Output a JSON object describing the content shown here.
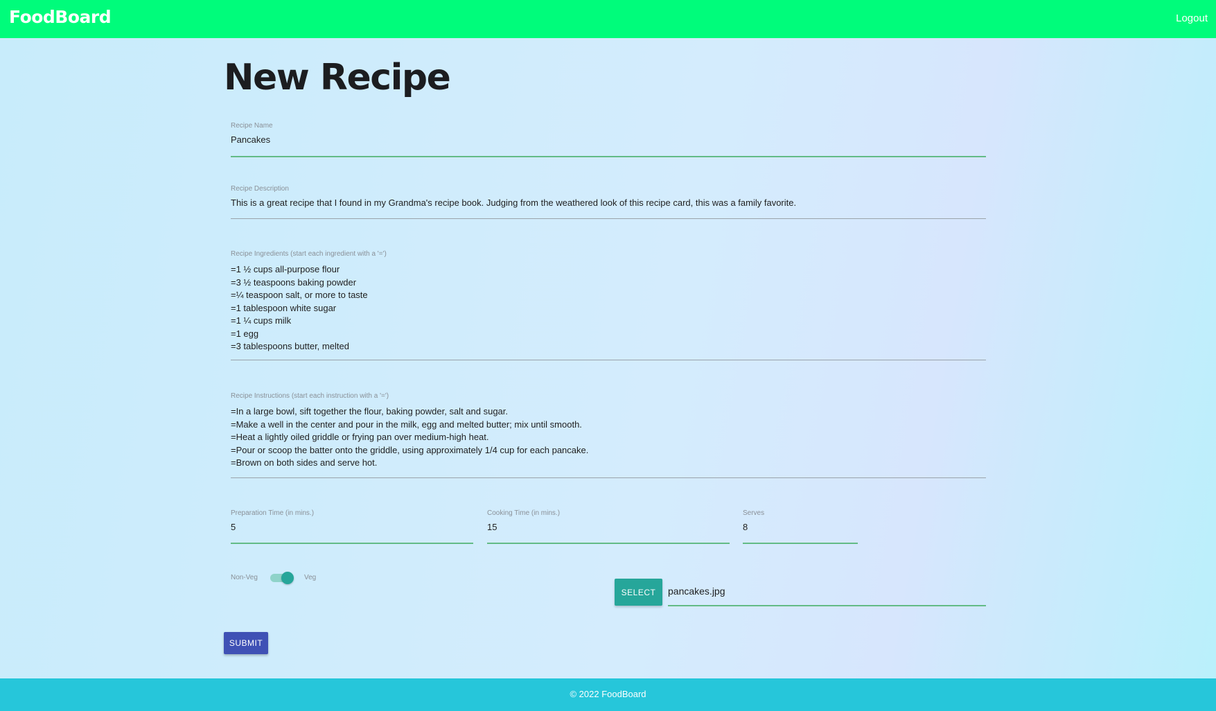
{
  "header": {
    "brand": "FoodBoard",
    "logout_label": "Logout"
  },
  "page": {
    "title": "New Recipe"
  },
  "form": {
    "recipe_name": {
      "label": "Recipe Name",
      "value": "Pancakes"
    },
    "recipe_description": {
      "label": "Recipe Description",
      "value": "This is a great recipe that I found in my Grandma's recipe book. Judging from the weathered look of this recipe card, this was a family favorite."
    },
    "recipe_ingredients": {
      "label": "Recipe Ingredients (start each ingredient with a '=')",
      "lines": [
        "=1 ½ cups all-purpose flour",
        "=3 ½ teaspoons baking powder",
        "=¼ teaspoon salt, or more to taste",
        "=1 tablespoon white sugar",
        "=1 ¼ cups milk",
        "=1 egg",
        "=3 tablespoons butter, melted"
      ]
    },
    "recipe_instructions": {
      "label": "Recipe Instructions (start each instruction with a '=')",
      "lines": [
        "=In a large bowl, sift together the flour, baking powder, salt and sugar.",
        "=Make a well in the center and pour in the milk, egg and melted butter; mix until smooth.",
        "=Heat a lightly oiled griddle or frying pan over medium-high heat.",
        "=Pour or scoop the batter onto the griddle, using approximately 1/4 cup for each pancake.",
        "=Brown on both sides and serve hot."
      ]
    },
    "preparation_time": {
      "label": "Preparation Time (in mins.)",
      "value": "5"
    },
    "cooking_time": {
      "label": "Cooking Time (in mins.)",
      "value": "15"
    },
    "serves": {
      "label": "Serves",
      "value": "8"
    },
    "veg_toggle": {
      "left_label": "Non-Veg",
      "right_label": "Veg",
      "checked": true
    },
    "file": {
      "select_label": "SELECT",
      "filename": "pancakes.jpg"
    },
    "submit_label": "SUBMIT"
  },
  "footer": {
    "copyright": "© 2022 FoodBoard"
  },
  "colors": {
    "navbar": "#00fc7b",
    "footer": "#26c6da",
    "active_underline": "#63bb86",
    "select_button": "#26a69a",
    "submit_button": "#3f51b5"
  }
}
